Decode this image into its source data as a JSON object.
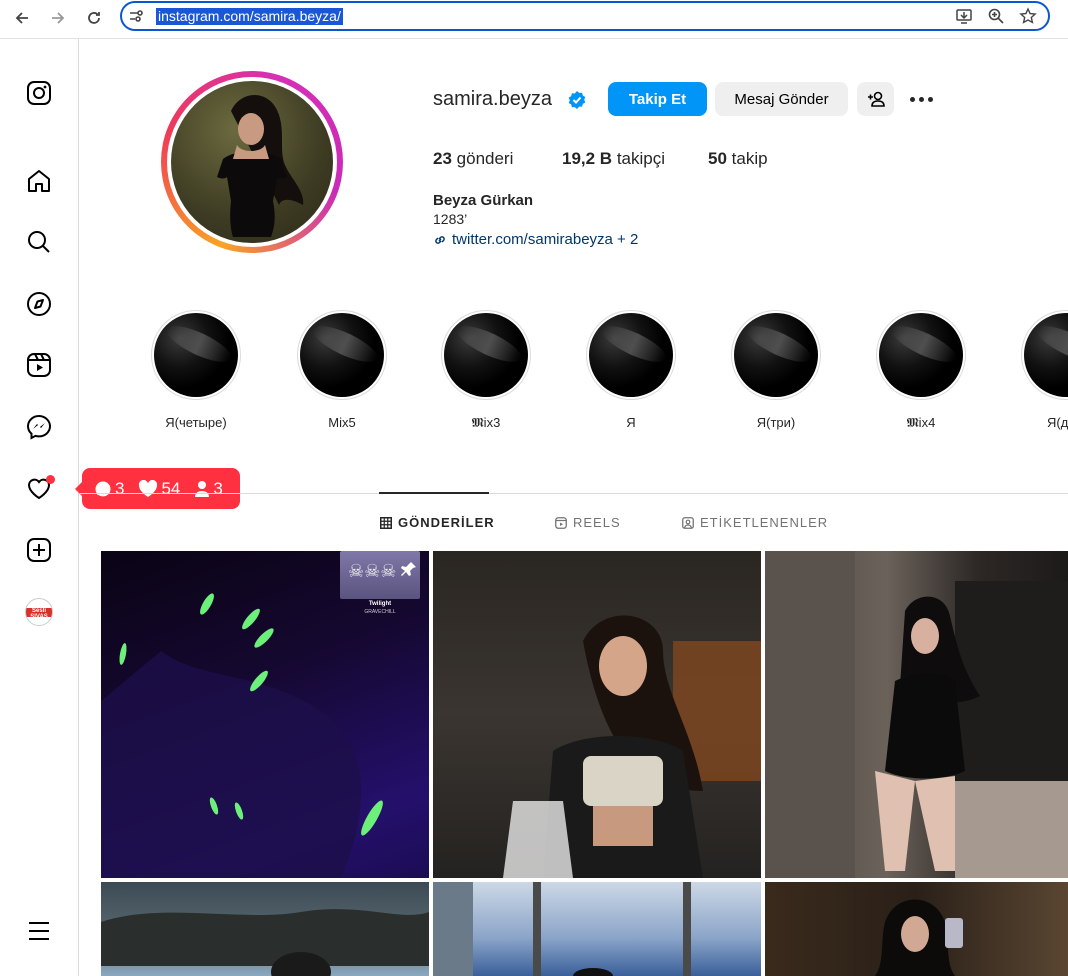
{
  "browser": {
    "url": "instagram.com/samira.beyza/"
  },
  "sidebar": {
    "items": [
      "instagram-logo",
      "home",
      "search",
      "explore",
      "reels",
      "messages",
      "notifications",
      "create",
      "profile",
      "more"
    ],
    "profile_avatar_text": "Sesli SIVAS"
  },
  "notifications_badge": {
    "comments": "3",
    "likes": "54",
    "follows": "3"
  },
  "profile": {
    "username": "samira.beyza",
    "verified": true,
    "follow_label": "Takip Et",
    "message_label": "Mesaj Gönder",
    "stats": {
      "posts_count": "23",
      "posts_label": "gönderi",
      "followers_count": "19,2 B",
      "followers_label": "takipçi",
      "following_count": "50",
      "following_label": "takip"
    },
    "full_name": "Beyza Gürkan",
    "bio": "1283’",
    "link": "twitter.com/samirabeyza + 2"
  },
  "highlights": [
    {
      "label": "Я(четыре)"
    },
    {
      "label": "Mix5"
    },
    {
      "label": "𝕸ix3"
    },
    {
      "label": "Я"
    },
    {
      "label": "Я(три)"
    },
    {
      "label": "𝕸ix4"
    },
    {
      "label": "Я(д"
    }
  ],
  "tabs": [
    {
      "label": "GÖNDERİLER",
      "active": true
    },
    {
      "label": "REELS",
      "active": false
    },
    {
      "label": "ETİKETLENENLER",
      "active": false
    }
  ],
  "post_overlay": {
    "music_title": "Twilight",
    "music_artist": "GRAVECHILL"
  },
  "colors": {
    "accent": "#0095f6",
    "badge": "#ff3040",
    "url_highlight": "#1a57d6"
  }
}
